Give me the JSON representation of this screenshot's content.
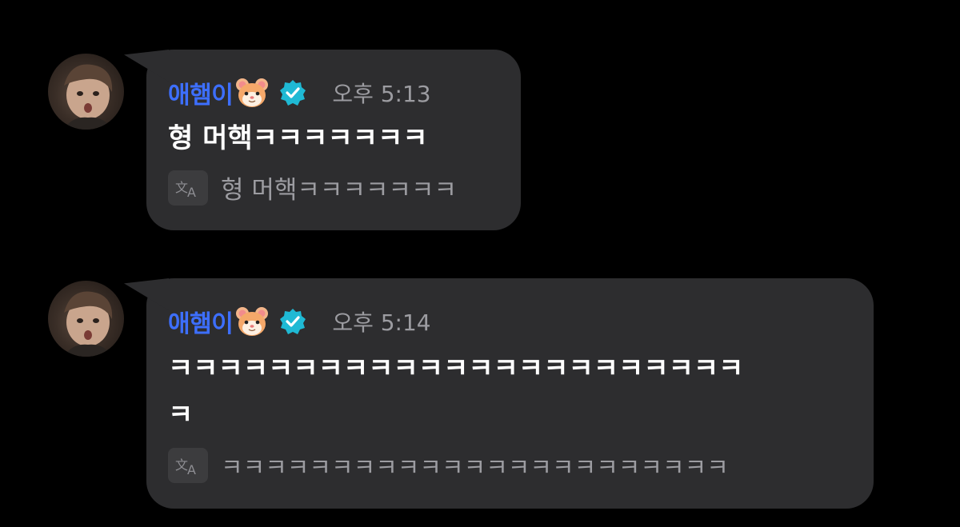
{
  "messages": [
    {
      "sender": "애햄이",
      "time": "오후 5:13",
      "text": "형 머핵ㅋㅋㅋㅋㅋㅋㅋ",
      "translation": "형 머핵ㅋㅋㅋㅋㅋㅋㅋ"
    },
    {
      "sender": "애햄이",
      "time": "오후 5:14",
      "text_line1": "ㅋㅋㅋㅋㅋㅋㅋㅋㅋㅋㅋㅋㅋㅋㅋㅋㅋㅋㅋㅋㅋㅋㅋ",
      "text_line2": "ㅋ",
      "translation": "ㅋㅋㅋㅋㅋㅋㅋㅋㅋㅋㅋㅋㅋㅋㅋㅋㅋㅋㅋㅋㅋㅋㅋ"
    }
  ],
  "icons": {
    "avatar": "avatar-photo",
    "sender_emoji": "hamster-emoji-icon",
    "verified": "verified-badge-icon",
    "translate": "translate-icon"
  },
  "colors": {
    "background": "#000000",
    "bubble": "#2d2d2f",
    "sender_name": "#3d6fff",
    "verified_badge": "#1fb9d4",
    "muted_text": "#9c9ca1"
  }
}
